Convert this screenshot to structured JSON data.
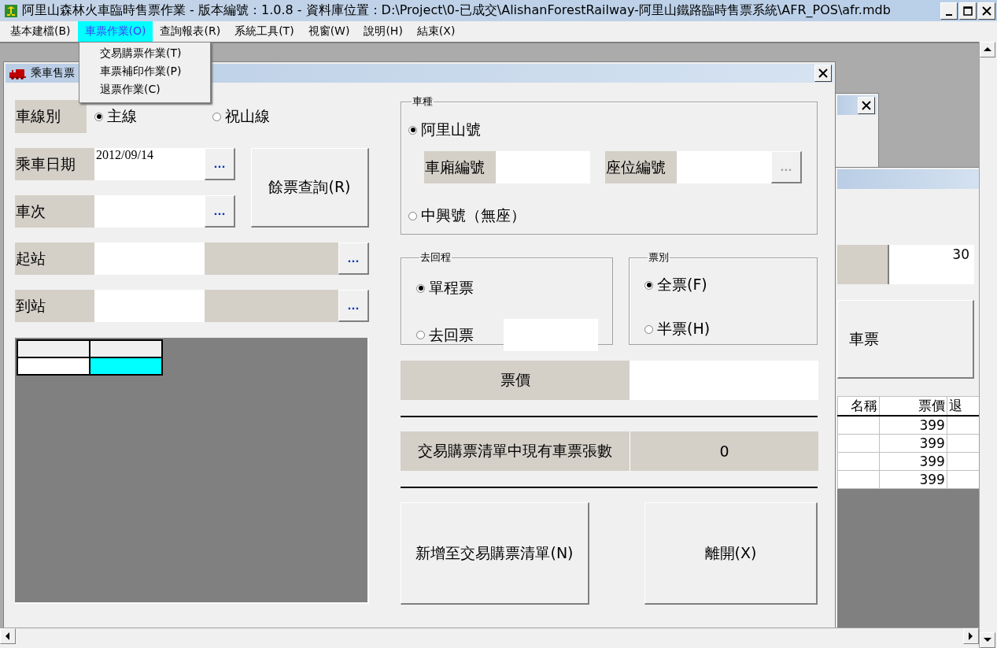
{
  "window": {
    "title": "阿里山森林火車臨時售票作業 - 版本編號：1.0.8 - 資料庫位置：D:\\Project\\0-已成交\\AlishanForestRailway-阿里山鐵路臨時售票系統\\AFR_POS\\afr.mdb"
  },
  "menu": [
    {
      "label": "基本建檔(B)",
      "selected": false
    },
    {
      "label": "車票作業(O)",
      "selected": true
    },
    {
      "label": "查詢報表(R)",
      "selected": false
    },
    {
      "label": "系統工具(T)",
      "selected": false
    },
    {
      "label": "視窗(W)",
      "selected": false
    },
    {
      "label": "說明(H)",
      "selected": false
    },
    {
      "label": "結束(X)",
      "selected": false
    }
  ],
  "open_menu": {
    "items": [
      "交易購票作業(T)",
      "車票補印作業(P)",
      "退票作業(C)"
    ]
  },
  "form": {
    "title": "乘車售票",
    "line": {
      "label": "車線別",
      "options": [
        {
          "label": "主線",
          "selected": true
        },
        {
          "label": "祝山線",
          "selected": false
        }
      ]
    },
    "date": {
      "label": "乘車日期",
      "value": "2012/09/14",
      "button": "..."
    },
    "train": {
      "label": "車次",
      "button": "..."
    },
    "query_button": "餘票查詢(R)",
    "from": {
      "label": "起站",
      "button": "..."
    },
    "to": {
      "label": "到站",
      "button": "..."
    },
    "grid": {
      "cells": [
        {
          "selected": false
        },
        {
          "selected": true
        }
      ]
    },
    "car_type": {
      "title": "車種",
      "options": [
        {
          "label": "阿里山號",
          "selected": true
        },
        {
          "label": "中興號（無座）",
          "selected": false
        }
      ],
      "car_no": {
        "label": "車廂編號"
      },
      "seat_no": {
        "label": "座位編號",
        "button": "...",
        "disabled": true
      }
    },
    "trip": {
      "title": "去回程",
      "options": [
        {
          "label": "單程票",
          "selected": true
        },
        {
          "label": "去回票",
          "selected": false
        }
      ]
    },
    "ticket_type": {
      "title": "票別",
      "options": [
        {
          "label": "全票(F)",
          "selected": true
        },
        {
          "label": "半票(H)",
          "selected": false
        }
      ]
    },
    "price": {
      "label": "票價"
    },
    "count": {
      "label": "交易購票清單中現有車票張數",
      "value": "0"
    },
    "buttons": [
      "新增至交易購票清單(N)",
      "離開(X)"
    ]
  },
  "back_form": {
    "field_value": "30",
    "button": "車票",
    "table": {
      "columns": [
        "名稱",
        "票價",
        "退"
      ],
      "rows": [
        [
          "399"
        ],
        [
          "399"
        ],
        [
          "399"
        ],
        [
          "399"
        ]
      ]
    }
  }
}
